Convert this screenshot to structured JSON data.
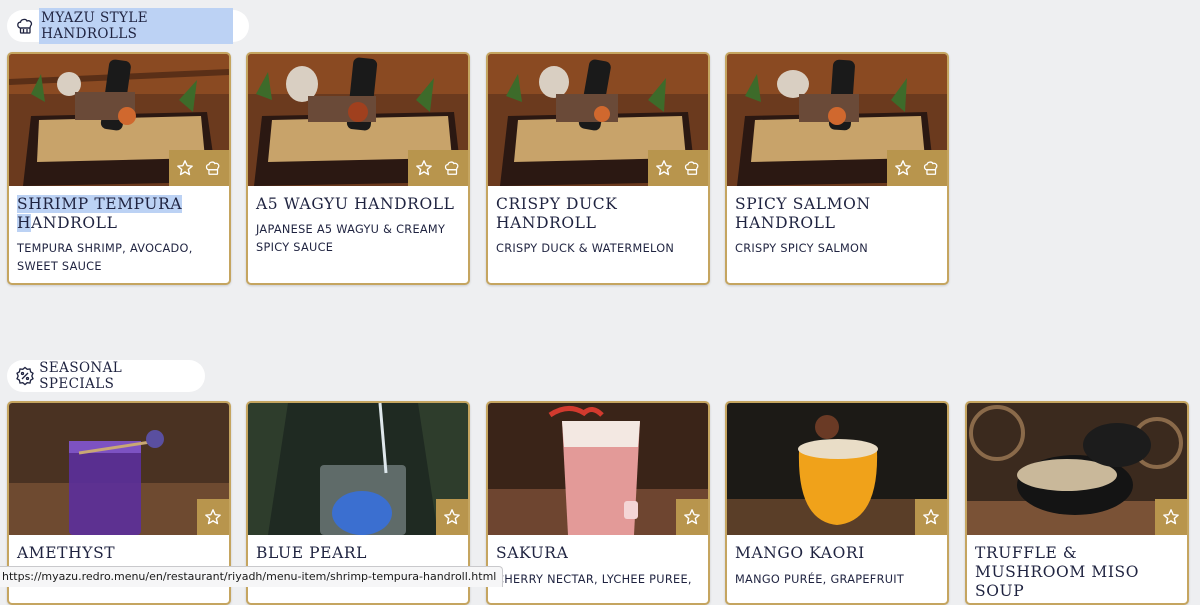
{
  "sections": [
    {
      "title": "MYAZU STYLE HANDROLLS",
      "icon": "chef-hat-icon",
      "items": [
        {
          "title_sel": "SHRIMP TEMPURA ",
          "title_sel2": "H",
          "title_rest": "ANDROLL",
          "description": "TEMPURA SHRIMP, AVOCADO, SWEET SAUCE"
        },
        {
          "title": "A5 WAGYU HANDROLL",
          "description": "JAPANESE A5 WAGYU & CREAMY SPICY SAUCE"
        },
        {
          "title": "CRISPY DUCK HANDROLL",
          "description": "CRISPY DUCK & WATERMELON"
        },
        {
          "title": "SPICY SALMON HANDROLL",
          "description": "CRISPY SPICY SALMON"
        }
      ]
    },
    {
      "title": "SEASONAL SPECIALS",
      "icon": "percent-badge-icon",
      "items": [
        {
          "title": "AMETHYST",
          "description": ""
        },
        {
          "title": "BLUE PEARL",
          "description": ""
        },
        {
          "title": "SAKURA",
          "description": "CHERRY NECTAR, LYCHEE PUREE,"
        },
        {
          "title": "MANGO KAORI",
          "description": "MANGO PURÉE, GRAPEFRUIT"
        },
        {
          "title": "TRUFFLE & MUSHROOM MISO SOUP",
          "description": ""
        }
      ]
    }
  ],
  "status_bar": {
    "url": "https://myazu.redro.menu/en/restaurant/riyadh/menu-item/shrimp-tempura-handroll.html"
  },
  "colors": {
    "accent_gold": "#b8954d",
    "card_border": "#c5a560",
    "text_navy": "#1f2340",
    "selection": "#bcd2f4"
  }
}
